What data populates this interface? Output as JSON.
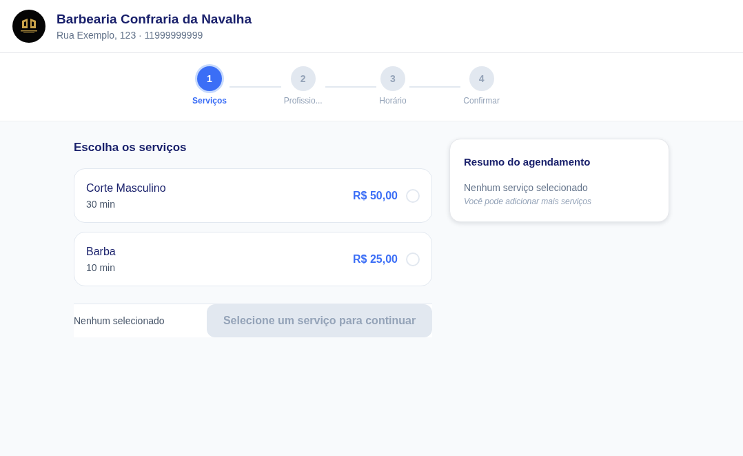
{
  "header": {
    "title": "Barbearia Confraria da Navalha",
    "subtitle": "Rua Exemplo, 123 · 11999999999"
  },
  "steps": [
    {
      "number": "1",
      "label": "Serviços",
      "selected": true
    },
    {
      "number": "2",
      "label": "Profissio...",
      "selected": false
    },
    {
      "number": "3",
      "label": "Horário",
      "selected": false
    },
    {
      "number": "4",
      "label": "Confirmar",
      "selected": false
    }
  ],
  "services_section": {
    "heading": "Escolha os serviços",
    "services": [
      {
        "name": "Corte Masculino",
        "duration": "30 min",
        "price": "R$ 50,00",
        "selected": false
      },
      {
        "name": "Barba",
        "duration": "10 min",
        "price": "R$ 25,00",
        "selected": false
      }
    ]
  },
  "action_bar": {
    "status": "Nenhum selecionado",
    "button": {
      "label": "Selecione um serviço para continuar",
      "disabled": true
    }
  },
  "summary": {
    "title": "Resumo do agendamento",
    "empty_text": "Nenhum serviço selecionado",
    "hint": "Você pode adicionar mais serviços"
  }
}
